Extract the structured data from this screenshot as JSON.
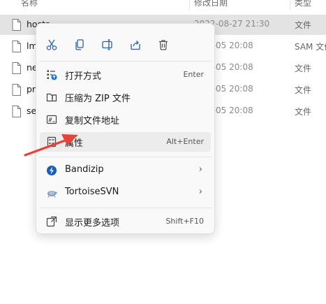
{
  "header": {
    "name_col": "名称",
    "date_col": "修改日期",
    "type_col": "类型"
  },
  "files": [
    {
      "name": "hosts",
      "date": "2022-08-27 21:30",
      "type": "文件"
    },
    {
      "name": "lm",
      "date": "...06-05 20:08",
      "type": "SAM 文件"
    },
    {
      "name": "ne",
      "date": "...06-05 20:08",
      "type": "文件"
    },
    {
      "name": "pr",
      "date": "...06-05 20:08",
      "type": "文件"
    },
    {
      "name": "se",
      "date": "...06-05 20:08",
      "type": "文件"
    }
  ],
  "quick_actions": [
    {
      "name": "cut-icon",
      "label": "剪切"
    },
    {
      "name": "copy-icon",
      "label": "复制"
    },
    {
      "name": "rename-icon",
      "label": "重命名"
    },
    {
      "name": "share-icon",
      "label": "共享"
    },
    {
      "name": "delete-icon",
      "label": "删除"
    }
  ],
  "menu": {
    "open_with": {
      "label": "打开方式",
      "shortcut": "Enter"
    },
    "compress_zip": {
      "label": "压缩为 ZIP 文件"
    },
    "copy_path": {
      "label": "复制文件地址"
    },
    "properties": {
      "label": "属性",
      "shortcut": "Alt+Enter"
    },
    "bandizip": {
      "label": "Bandizip"
    },
    "tortoisesvn": {
      "label": "TortoiseSVN"
    },
    "more_options": {
      "label": "显示更多选项",
      "shortcut": "Shift+F10"
    }
  },
  "colors": {
    "selection": "#e3e3e3",
    "accent": "#1a73c9",
    "arrow": "#e8413a"
  }
}
